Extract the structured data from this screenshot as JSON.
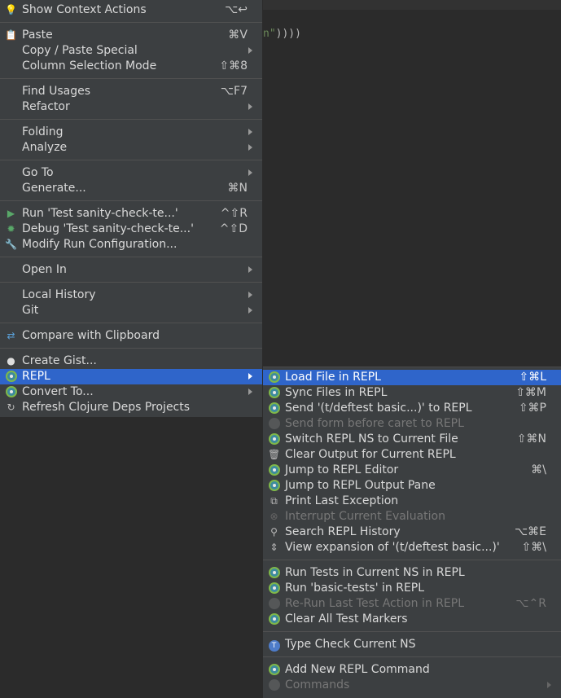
{
  "editor": {
    "code_tail_str": "n\"",
    "code_tail_rest": "))))"
  },
  "main_menu": {
    "items": [
      {
        "label": "Show Context Actions",
        "shortcut": "⌥↩",
        "icon": "bulb-icon"
      },
      {
        "label": "Paste",
        "shortcut": "⌘V",
        "icon": "clipboard-icon"
      },
      {
        "label": "Copy / Paste Special"
      },
      {
        "label": "Column Selection Mode",
        "shortcut": "⇧⌘8"
      },
      {
        "label": "Find Usages",
        "shortcut": "⌥F7"
      },
      {
        "label": "Refactor"
      },
      {
        "label": "Folding"
      },
      {
        "label": "Analyze"
      },
      {
        "label": "Go To"
      },
      {
        "label": "Generate...",
        "shortcut": "⌘N"
      },
      {
        "label": "Run 'Test sanity-check-te...'",
        "shortcut": "^⇧R",
        "icon": "run-icon"
      },
      {
        "label": "Debug 'Test sanity-check-te...'",
        "shortcut": "^⇧D",
        "icon": "debug-icon"
      },
      {
        "label": "Modify Run Configuration...",
        "icon": "wrench-icon"
      },
      {
        "label": "Open In"
      },
      {
        "label": "Local History"
      },
      {
        "label": "Git"
      },
      {
        "label": "Compare with Clipboard",
        "icon": "compare-icon"
      },
      {
        "label": "Create Gist...",
        "icon": "github-icon"
      },
      {
        "label": "REPL",
        "icon": "cursive-icon"
      },
      {
        "label": "Convert To...",
        "icon": "cursive-icon"
      },
      {
        "label": "Refresh Clojure Deps Projects",
        "icon": "refresh-icon"
      }
    ]
  },
  "repl_submenu": {
    "items": [
      {
        "label": "Load File in REPL",
        "shortcut": "⇧⌘L",
        "icon": "cursive-icon"
      },
      {
        "label": "Sync Files in REPL",
        "shortcut": "⇧⌘M",
        "icon": "cursive-icon"
      },
      {
        "label": "Send '(t/deftest basic...)' to REPL",
        "shortcut": "⇧⌘P",
        "icon": "cursive-icon"
      },
      {
        "label": "Send form before caret to REPL",
        "icon": "cursive-disabled-icon"
      },
      {
        "label": "Switch REPL NS to Current File",
        "shortcut": "⇧⌘N",
        "icon": "cursive-icon"
      },
      {
        "label": "Clear Output for Current REPL",
        "icon": "trash-icon"
      },
      {
        "label": "Jump to REPL Editor",
        "shortcut": "⌘\\",
        "icon": "cursive-icon"
      },
      {
        "label": "Jump to REPL Output Pane",
        "icon": "cursive-icon"
      },
      {
        "label": "Print Last Exception",
        "icon": "copy-window-icon"
      },
      {
        "label": "Interrupt Current Evaluation",
        "icon": "stop-icon"
      },
      {
        "label": "Search REPL History",
        "shortcut": "⌥⌘E",
        "icon": "search-icon"
      },
      {
        "label": "View expansion of '(t/deftest basic...)'",
        "shortcut": "⇧⌘\\",
        "icon": "expand-icon"
      },
      {
        "label": "Run Tests in Current NS in REPL",
        "icon": "cursive-icon"
      },
      {
        "label": "Run 'basic-tests' in REPL",
        "icon": "cursive-icon"
      },
      {
        "label": "Re-Run Last Test Action in REPL",
        "shortcut": "⌥⌃R",
        "icon": "cursive-disabled-icon"
      },
      {
        "label": "Clear All Test Markers",
        "icon": "cursive-icon"
      },
      {
        "label": "Type Check Current NS",
        "icon": "typed-icon"
      },
      {
        "label": "Add New REPL Command",
        "icon": "cursive-icon"
      },
      {
        "label": "Commands",
        "icon": "cursive-disabled-icon"
      }
    ]
  },
  "colors": {
    "selection": "#2f65ca",
    "menu_bg": "#3c3f41",
    "editor_bg": "#2b2b2b"
  }
}
